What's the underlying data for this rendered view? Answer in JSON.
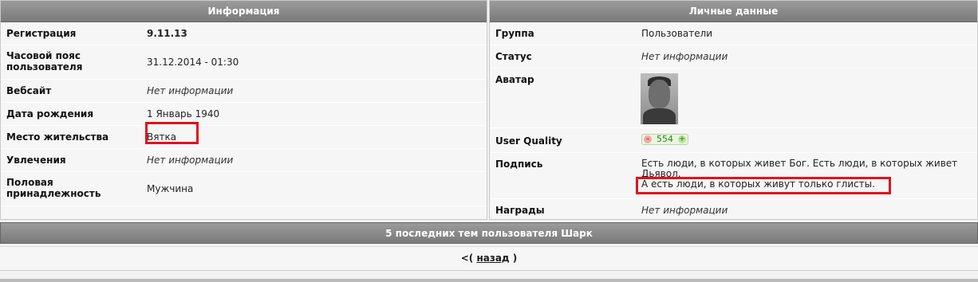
{
  "info": {
    "header": "Информация",
    "rows": [
      {
        "label": "Регистрация",
        "value": "9.11.13"
      },
      {
        "label": "Часовой пояс пользователя",
        "value": "31.12.2014 - 01:30"
      },
      {
        "label": "Вебсайт",
        "value": "Нет информации"
      },
      {
        "label": "Дата рождения",
        "value": "1 Январь 1940"
      },
      {
        "label": "Место жительства",
        "value": "Вятка"
      },
      {
        "label": "Увлечения",
        "value": "Нет информации"
      },
      {
        "label": "Половая принадлежность",
        "value": "Мужчина"
      }
    ]
  },
  "personal": {
    "header": "Личные данные",
    "group_label": "Группа",
    "group_value": "Пользователи",
    "status_label": "Статус",
    "status_value": "Нет информации",
    "avatar_label": "Аватар",
    "uq_label": "User Quality",
    "uq_minus": "–",
    "uq_value": "554",
    "uq_plus": "+",
    "signature_label": "Подпись",
    "signature_line1": "Есть люди, в которых живет Бог. Есть люди, в которых живет Дьявол.",
    "signature_line2": "А есть люди, в которых живут только глисты.",
    "awards_label": "Награды",
    "awards_value": "Нет информации"
  },
  "topics_bar": "5 последних тем пользователя Шарк",
  "back": {
    "prefix": "<(",
    "link": "назад",
    "suffix": ")"
  },
  "colors": {
    "highlight": "#e2121a",
    "header_bg": "#8a8a8a"
  }
}
